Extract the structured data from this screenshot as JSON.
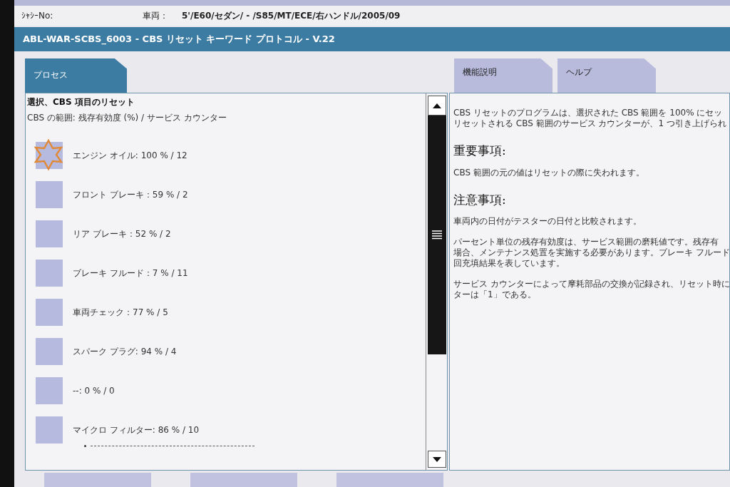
{
  "header": {
    "chassis_label": "ｼｬｼｰNo:",
    "vehicle_label": "車両：",
    "vehicle_value": "5'/E60/セダン/ - /S85/MT/ECE/右ハンドル/2005/09"
  },
  "title_bar": {
    "title": "ABL-WAR-SCBS_6003 - CBS リセット キーワード プロトコル - V.22"
  },
  "left_tabs": [
    {
      "label": "プロセス",
      "selected": true
    }
  ],
  "right_tabs": [
    {
      "label": "機能説明",
      "selected": false
    },
    {
      "label": "ヘルプ",
      "selected": false
    }
  ],
  "process_panel": {
    "heading": "選択、CBS 項目のリセット",
    "subheading": "CBS の範囲: 残存有効度 (%) / サービス カウンター",
    "items": [
      {
        "label": "エンジン オイル: 100 % / 12",
        "selected": true
      },
      {
        "label": "フロント ブレーキ：59 % / 2",
        "selected": false
      },
      {
        "label": "リア ブレーキ：52 % / 2",
        "selected": false
      },
      {
        "label": "ブレーキ フルード：7 % / 11",
        "selected": false
      },
      {
        "label": "車両チェック：77 % / 5",
        "selected": false
      },
      {
        "label": "スパーク プラグ: 94 % / 4",
        "selected": false
      },
      {
        "label": "--: 0 % / 0",
        "selected": false
      },
      {
        "label": "マイクロ フィルター: 86 % / 10",
        "selected": false
      }
    ]
  },
  "info_panel": {
    "blocks": [
      {
        "kind": "text",
        "lines": [
          "CBS リセットのプログラムは、選択された CBS 範囲を 100% にセッ",
          "リセットされる CBS 範囲のサービス カウンターが、1 つ引き上げられ"
        ]
      },
      {
        "kind": "heading",
        "lines": [
          "重要事項:"
        ]
      },
      {
        "kind": "text",
        "lines": [
          "CBS 範囲の元の値はリセットの際に失われます。"
        ]
      },
      {
        "kind": "heading",
        "lines": [
          "注意事項:"
        ]
      },
      {
        "kind": "text",
        "lines": [
          "車両内の日付がテスターの日付と比較されます。"
        ]
      },
      {
        "kind": "text",
        "lines": [
          "パーセント単位の残存有効度は、サービス範囲の磨耗値です。残存有",
          "場合、メンテナンス処置を実施する必要があります。ブレーキ フルード",
          "回充填結果を表しています。"
        ]
      },
      {
        "kind": "text",
        "lines": [
          "サービス カウンターによって摩耗部品の交換が記録され、リセット時に",
          "ターは「1」である。"
        ]
      }
    ]
  },
  "bottom_buttons": [
    {
      "kind": "button"
    },
    {
      "kind": "button"
    },
    {
      "kind": "button"
    }
  ]
}
